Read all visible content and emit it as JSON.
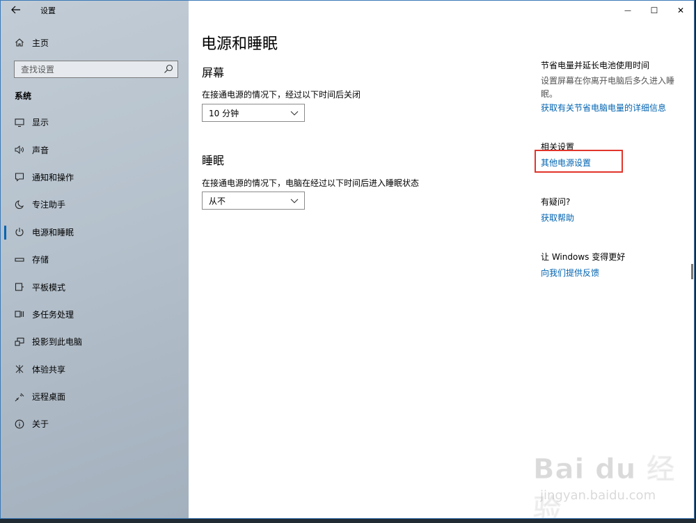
{
  "window": {
    "title": "设置",
    "controls": {
      "minimize": "—",
      "maximize": "☐",
      "close": "✕"
    }
  },
  "sidebar": {
    "home_label": "主页",
    "search_placeholder": "查找设置",
    "group_label": "系统",
    "items": [
      {
        "label": "显示",
        "icon": "monitor-icon"
      },
      {
        "label": "声音",
        "icon": "speaker-icon"
      },
      {
        "label": "通知和操作",
        "icon": "notification-icon"
      },
      {
        "label": "专注助手",
        "icon": "moon-icon"
      },
      {
        "label": "电源和睡眠",
        "icon": "power-icon",
        "active": true
      },
      {
        "label": "存储",
        "icon": "storage-icon"
      },
      {
        "label": "平板模式",
        "icon": "tablet-icon"
      },
      {
        "label": "多任务处理",
        "icon": "multitask-icon"
      },
      {
        "label": "投影到此电脑",
        "icon": "project-icon"
      },
      {
        "label": "体验共享",
        "icon": "share-icon"
      },
      {
        "label": "远程桌面",
        "icon": "remote-icon"
      },
      {
        "label": "关于",
        "icon": "info-icon"
      }
    ]
  },
  "main": {
    "title": "电源和睡眠",
    "screen": {
      "heading": "屏幕",
      "desc": "在接通电源的情况下，经过以下时间后关闭",
      "value": "10 分钟"
    },
    "sleep": {
      "heading": "睡眠",
      "desc": "在接通电源的情况下，电脑在经过以下时间后进入睡眠状态",
      "value": "从不"
    }
  },
  "right": {
    "save_heading": "节省电量并延长电池使用时间",
    "save_text": "设置屏幕在你离开电脑后多久进入睡眠。",
    "save_link": "获取有关节省电脑电量的详细信息",
    "related_heading": "相关设置",
    "related_link": "其他电源设置",
    "question_heading": "有疑问?",
    "question_link": "获取帮助",
    "better_heading": "让 Windows 变得更好",
    "better_link": "向我们提供反馈"
  },
  "watermark": {
    "main": "Bai du 经验",
    "sub": "jingyan.baidu.com"
  },
  "colors": {
    "accent": "#0063b1",
    "highlight_box": "#e2342b"
  }
}
